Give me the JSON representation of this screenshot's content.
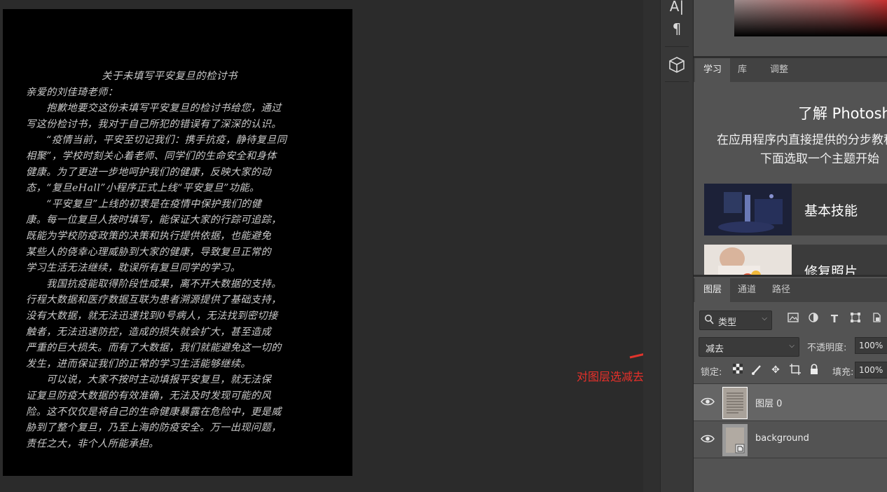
{
  "document": {
    "lines": [
      "关于未填写平安复旦的检讨书",
      "亲爱的刘佳琦老师：",
      "　　抱歉地要交这份未填写平安复旦的检讨书给您，通过",
      "写这份检讨书，我对于自己所犯的错误有了深深的认识。",
      "　　“疫情当前，平安至切记我们：携手抗疫，静待复旦同",
      "相聚”，学校时刻关心着老师、同学们的生命安全和身体",
      "健康。为了更进一步地呵护我们的健康，反映大家的动",
      "态，“复旦eHall”小程序正式上线“平安复旦”功能。",
      "　　“平安复旦”上线的初衷是在疫情中保护我们的健",
      "康。每一位复旦人按时填写，能保证大家的行踪可追踪，",
      "既能为学校防疫政策的决策和执行提供依据，也能避免",
      "某些人的侥幸心理威胁到大家的健康，导致复旦正常的",
      "学习生活无法继续，耽误所有复旦同学的学习。",
      "　　我国抗疫能取得阶段性成果，离不开大数据的支持。",
      "行程大数据和医疗数据互联为患者溯源提供了基础支持，",
      "没有大数据，就无法迅速找到0号病人，无法找到密切接",
      "触者，无法迅速防控，造成的损失就会扩大，甚至造成",
      "严重的巨大损失。而有了大数据，我们就能避免这一切的",
      "发生，进而保证我们的正常的学习生活能够继续。",
      "　　可以说，大家不按时主动填报平安复旦，就无法保",
      "证复旦防疫大数据的有效准确，无法及时发现可能的风",
      "险。这不仅仅是将自己的生命健康暴露在危险中，更是威",
      "胁到了整个复旦，乃至上海的防疫安全。万一出现问题，",
      "责任之大，非个人所能承担。"
    ]
  },
  "annotation": {
    "label": "对图层选减去",
    "color": "#e8302a"
  },
  "tools": {
    "items": [
      {
        "name": "character",
        "glyph": "A|"
      },
      {
        "name": "paragraph",
        "glyph": "¶"
      },
      {
        "name": "3d",
        "glyph": "⬡"
      }
    ]
  },
  "learn_panel": {
    "tabs": [
      "学习",
      "库",
      "调整"
    ],
    "active_tab": "学习",
    "title": "了解 Photoshop",
    "desc_line1": "在应用程序内直接提供的分步教程。",
    "desc_line2": "下面选取一个主题开始",
    "topics": [
      {
        "label": "基本技能",
        "icon": "basic-skills-thumbnail"
      },
      {
        "label": "修复照片",
        "icon": "fix-photo-thumbnail"
      }
    ]
  },
  "layers_panel": {
    "tabs": [
      "图层",
      "通道",
      "路径"
    ],
    "active_tab": "图层",
    "filter_label": "类型",
    "blend_mode": "减去",
    "opacity_label": "不透明度:",
    "opacity_value": "100%",
    "lock_label": "锁定:",
    "fill_label": "填充:",
    "fill_value": "100%",
    "layers": [
      {
        "name": "图层 0",
        "selected": true,
        "visible": true
      },
      {
        "name": "background",
        "selected": false,
        "visible": true
      }
    ]
  }
}
